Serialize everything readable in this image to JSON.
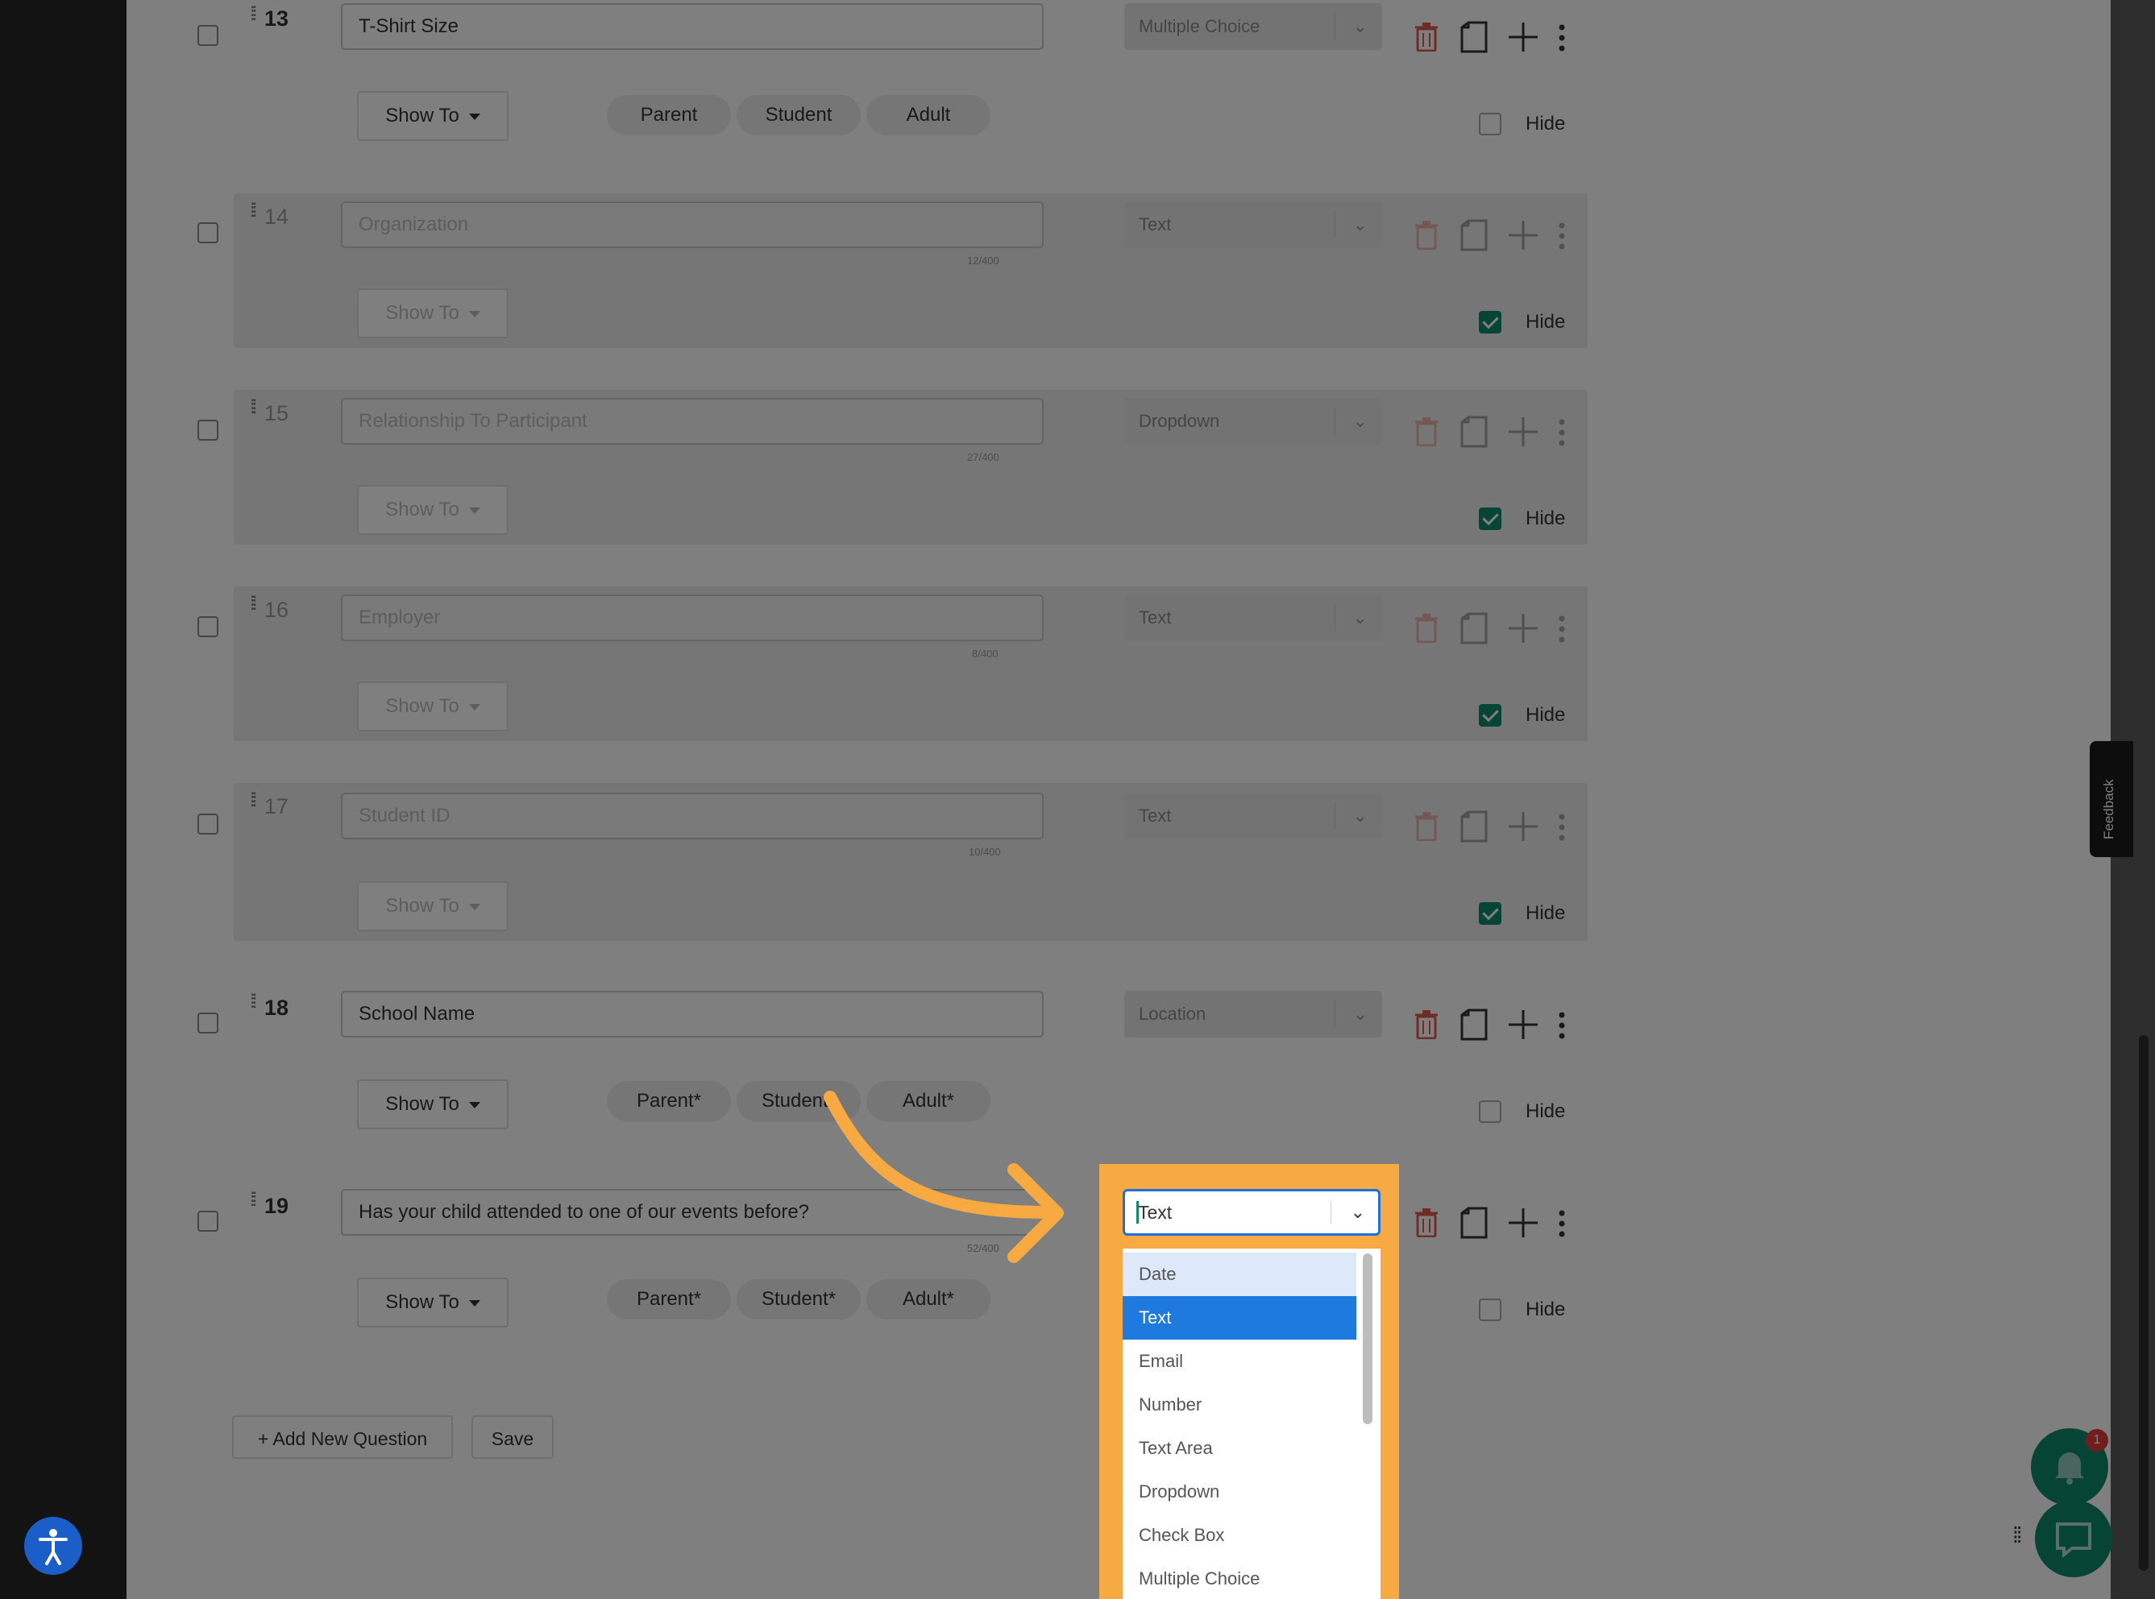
{
  "questions": [
    {
      "num": "13",
      "label": "T-Shirt Size",
      "counter": "",
      "type": "Multiple Choice",
      "show_to": "Show To",
      "audiences": [
        "Parent",
        "Student",
        "Adult"
      ],
      "hide_label": "Hide",
      "hidden": false
    },
    {
      "num": "14",
      "label": "Organization",
      "counter": "12/400",
      "type": "Text",
      "show_to": "Show To",
      "audiences": [],
      "hide_label": "Hide",
      "hidden": true
    },
    {
      "num": "15",
      "label": "Relationship To Participant",
      "counter": "27/400",
      "type": "Dropdown",
      "show_to": "Show To",
      "audiences": [],
      "hide_label": "Hide",
      "hidden": true
    },
    {
      "num": "16",
      "label": "Employer",
      "counter": "8/400",
      "type": "Text",
      "show_to": "Show To",
      "audiences": [],
      "hide_label": "Hide",
      "hidden": true
    },
    {
      "num": "17",
      "label": "Student ID",
      "counter": "10/400",
      "type": "Text",
      "show_to": "Show To",
      "audiences": [],
      "hide_label": "Hide",
      "hidden": true
    },
    {
      "num": "18",
      "label": "School Name",
      "counter": "",
      "type": "Location",
      "show_to": "Show To",
      "audiences": [
        "Parent*",
        "Student*",
        "Adult*"
      ],
      "hide_label": "Hide",
      "hidden": false
    },
    {
      "num": "19",
      "label": "Has your child attended to one of our events before?",
      "counter": "52/400",
      "type": "Text",
      "show_to": "Show To",
      "audiences": [
        "Parent*",
        "Student*",
        "Adult*"
      ],
      "hide_label": "Hide",
      "hidden": false
    }
  ],
  "footer": {
    "add_question": "+ Add New Question",
    "save": "Save"
  },
  "type_dropdown": {
    "value": "Text",
    "options": [
      "Date",
      "Text",
      "Email",
      "Number",
      "Text Area",
      "Dropdown",
      "Check Box",
      "Multiple Choice"
    ],
    "hovered": "Date",
    "selected": "Text"
  },
  "widgets": {
    "feedback": "Feedback",
    "notification_count": "1"
  },
  "colors": {
    "accent_green": "#0d8a6a",
    "delete_red": "#e05a4d",
    "highlight_orange": "#f7a942",
    "select_blue": "#1f7ae0"
  },
  "icons": [
    "drag-handle-icon",
    "trash-icon",
    "copy-icon",
    "plus-icon",
    "kebab-menu-icon",
    "chevron-down-icon",
    "caret-down-icon",
    "accessibility-icon",
    "bell-icon",
    "chat-icon",
    "grip-icon",
    "arrow-annotation"
  ]
}
